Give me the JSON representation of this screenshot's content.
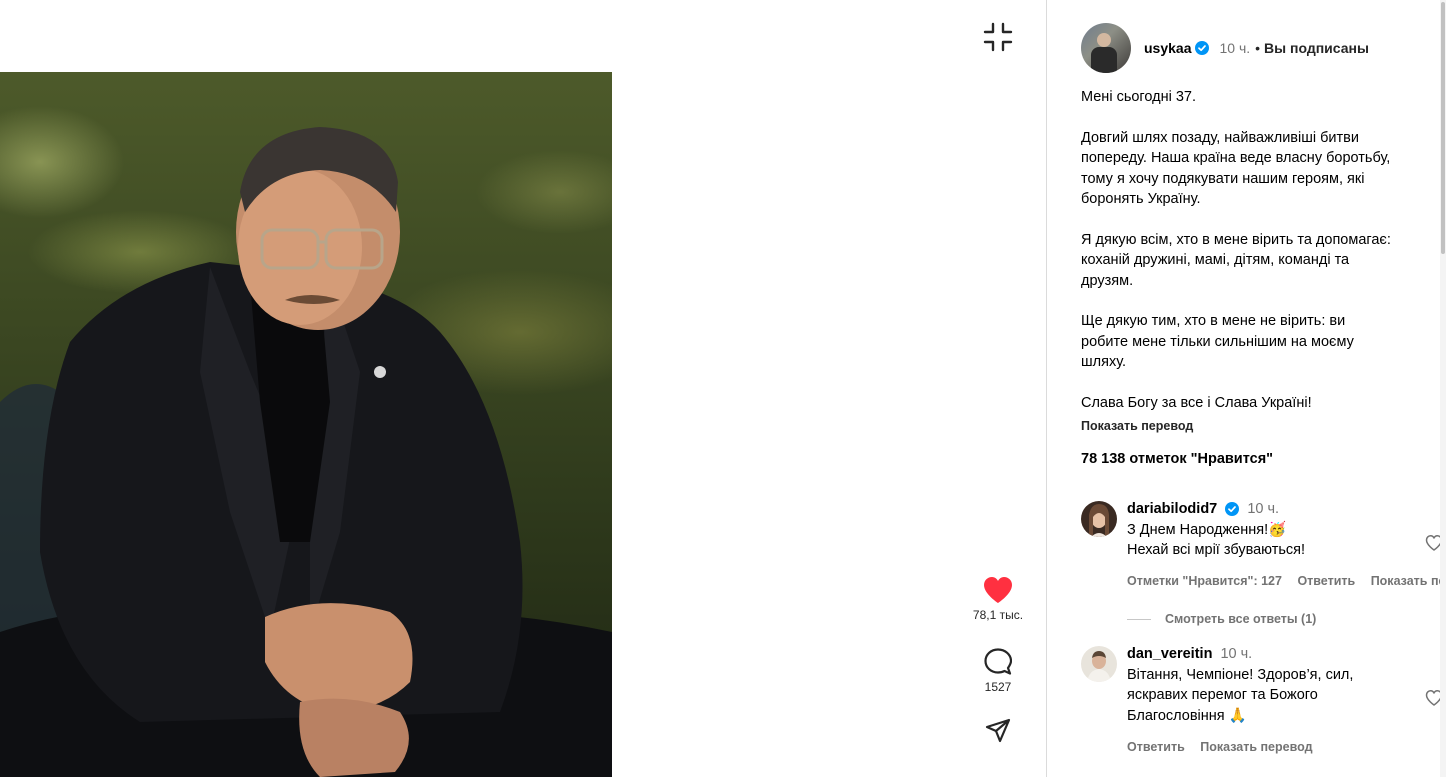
{
  "post": {
    "username": "usykaa",
    "time": "10 ч.",
    "dot": "•",
    "follow_status": "Вы подписаны",
    "caption": [
      "Мені сьогодні 37.",
      "Довгий шлях позаду, найважливіші битви попереду. Наша країна веде власну боротьбу, тому я хочу подякувати нашим героям, які боронять Україну.",
      "Я дякую всім, хто в мене вірить та допомагає: коханій дружині, мамі, дітям, команді та друзям.",
      "Ще дякую тим, хто в мене не вірить: ви робите мене тільки сильнішим на моєму шляху.",
      "Слава Богу за все і Слава Україні!"
    ],
    "show_translation": "Показать перевод",
    "likes_text": "78 138 отметок \"Нравится\""
  },
  "actions": {
    "likes_count": "78,1 тыс.",
    "comments_count": "1527",
    "like_color": "#ff3040"
  },
  "comments": [
    {
      "username": "dariabilodid7",
      "verified": true,
      "time": "10 ч.",
      "line1": "З Днем Народження!🥳",
      "line2": "Нехай всі мрії збуваються!",
      "likes": "Отметки \"Нравится\": 127",
      "reply": "Ответить",
      "translate": "Показать перевод"
    },
    {
      "username": "dan_vereitin",
      "verified": false,
      "time": "10 ч.",
      "line1": "Вітання, Чемпіоне! Здоров’я, сил,",
      "line2": "яскравих перемог та Божого",
      "line3": "Благословіння 🙏",
      "reply": "Ответить",
      "translate": "Показать перевод"
    }
  ],
  "view_replies": "Смотреть все ответы (1)",
  "colors": {
    "verified": "#0095f6",
    "secondary_text": "#737373",
    "border": "#dbdbdb"
  }
}
